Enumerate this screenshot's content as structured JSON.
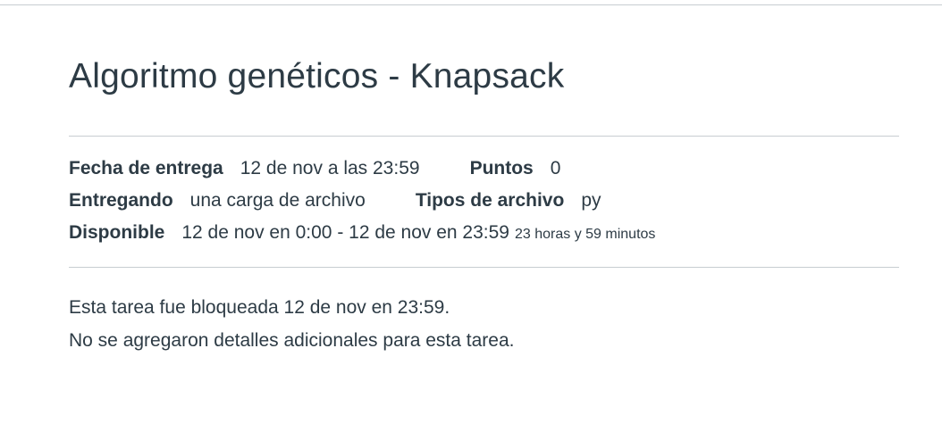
{
  "assignment": {
    "title": "Algoritmo genéticos - Knapsack",
    "details": {
      "due_label": "Fecha de entrega",
      "due_value": "12 de nov a las 23:59",
      "points_label": "Puntos",
      "points_value": "0",
      "submitting_label": "Entregando",
      "submitting_value": "una carga de archivo",
      "file_types_label": "Tipos de archivo",
      "file_types_value": "py",
      "available_label": "Disponible",
      "available_value": "12 de nov en 0:00 - 12 de nov en 23:59",
      "available_duration": "23 horas y 59 minutos"
    },
    "locked_message": "Esta tarea fue bloqueada 12 de nov en 23:59.",
    "no_details_message": "No se agregaron detalles adicionales para esta tarea."
  },
  "colors": {
    "text": "#2d3b45",
    "divider": "#c7cdd1",
    "background": "#ffffff"
  }
}
